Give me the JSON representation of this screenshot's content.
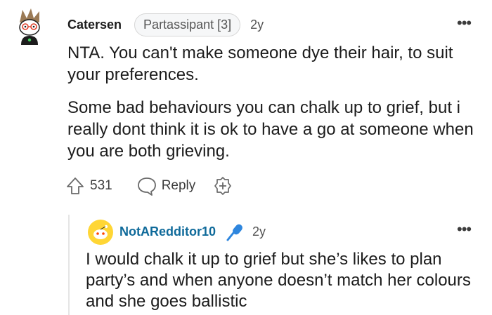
{
  "comment": {
    "username": "Catersen",
    "flair": "Partassipant [3]",
    "age": "2y",
    "paragraphs": [
      "NTA. You can't make someone dye their hair, to suit your preferences.",
      "Some bad behaviours you can chalk up to grief, but i really dont think it is ok to have a go at someone when you are both grieving."
    ],
    "votes": "531",
    "reply_label": "Reply",
    "more_label": "•••"
  },
  "reply": {
    "username": "NotARedditor10",
    "age": "2y",
    "text": "I would chalk it up to grief but she’s likes to plan party’s and when anyone doesn’t match her colours and she goes ballistic",
    "more_label": "•••"
  }
}
